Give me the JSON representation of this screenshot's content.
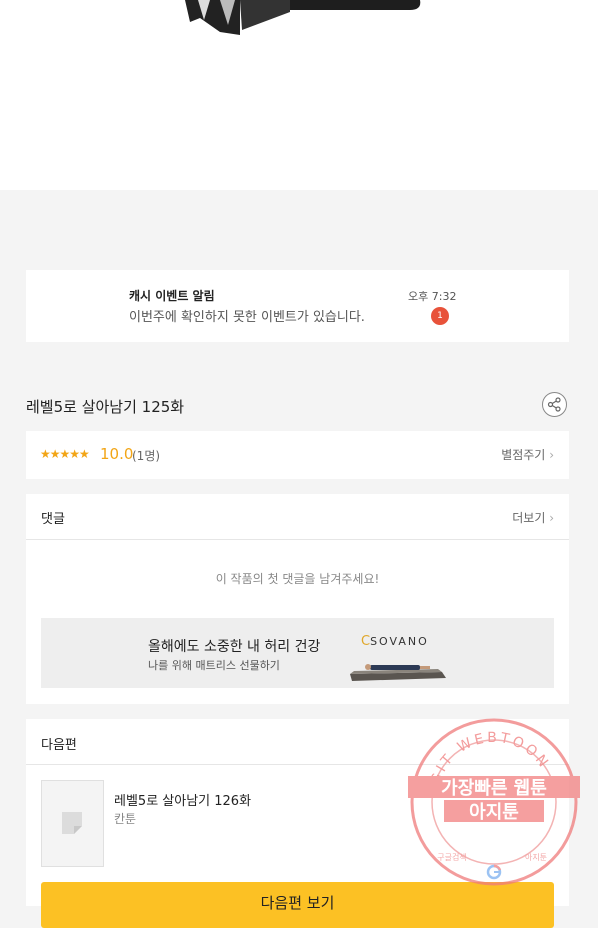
{
  "notification": {
    "title": "캐시 이벤트 알림",
    "message": "이번주에 확인하지 못한 이벤트가 있습니다.",
    "time": "오후 7:32",
    "badge": "1"
  },
  "episode": {
    "title": "레벨5로 살아남기 125화"
  },
  "rating": {
    "stars": "★★★★★",
    "score": "10.0",
    "count": "(1명)",
    "rate_label": "별점주기",
    "rate_chevron": "›"
  },
  "comments": {
    "header": "댓글",
    "more_label": "더보기",
    "more_chevron": "›",
    "empty_text": "이 작품의 첫 댓글을 남겨주세요!"
  },
  "ad": {
    "title": "올해에도 소중한 내 허리 건강",
    "subtitle": "나를 위해 매트리스 선물하기",
    "logo": "SOVANO"
  },
  "next_episode": {
    "header": "다음편",
    "title": "레벨5로 살아남기 126화",
    "author": "칸툰",
    "button_label": "다음편 보기"
  },
  "watermark": {
    "ring_text": "AGIT WEBTOON",
    "line1": "가장빠른 웹툰",
    "line2": "아지툰",
    "bottom_left": "구글검색",
    "bottom_right": "아지툰"
  },
  "colors": {
    "accent_yellow": "#fcc124",
    "rating_orange": "#f2a516",
    "badge_red": "#e8523a",
    "stamp_red": "#e84a4a"
  }
}
